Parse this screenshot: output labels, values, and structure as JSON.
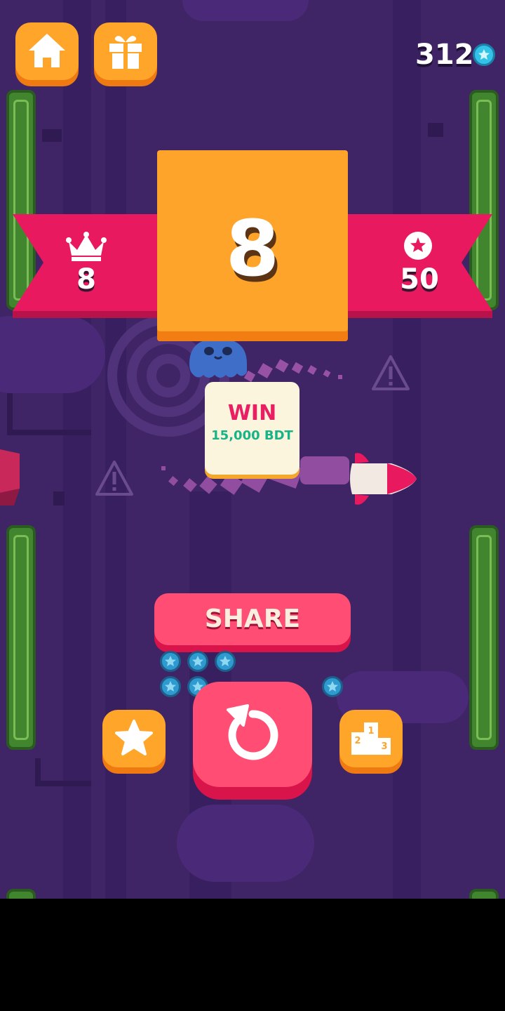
{
  "hud": {
    "home_icon": "home-icon",
    "gift_icon": "gift-icon",
    "coins": "312",
    "coin_icon": "star-coin-icon"
  },
  "results": {
    "best_icon": "crown-icon",
    "best": "8",
    "score": "8",
    "stars_icon": "star-badge-icon",
    "stars": "50"
  },
  "promo": {
    "title": "WIN",
    "amount": "15,000 BDT"
  },
  "actions": {
    "share_label": "SHARE",
    "rate_icon": "star-icon",
    "replay_icon": "replay-icon",
    "leaderboard_icon": "podium-icon"
  },
  "colors": {
    "background": "#3f2466",
    "orange": "#ffa52a",
    "pink": "#ff4d73",
    "ribbon": "#e8195f",
    "coin": "#33c2e8",
    "promo_amount": "#18b386"
  }
}
